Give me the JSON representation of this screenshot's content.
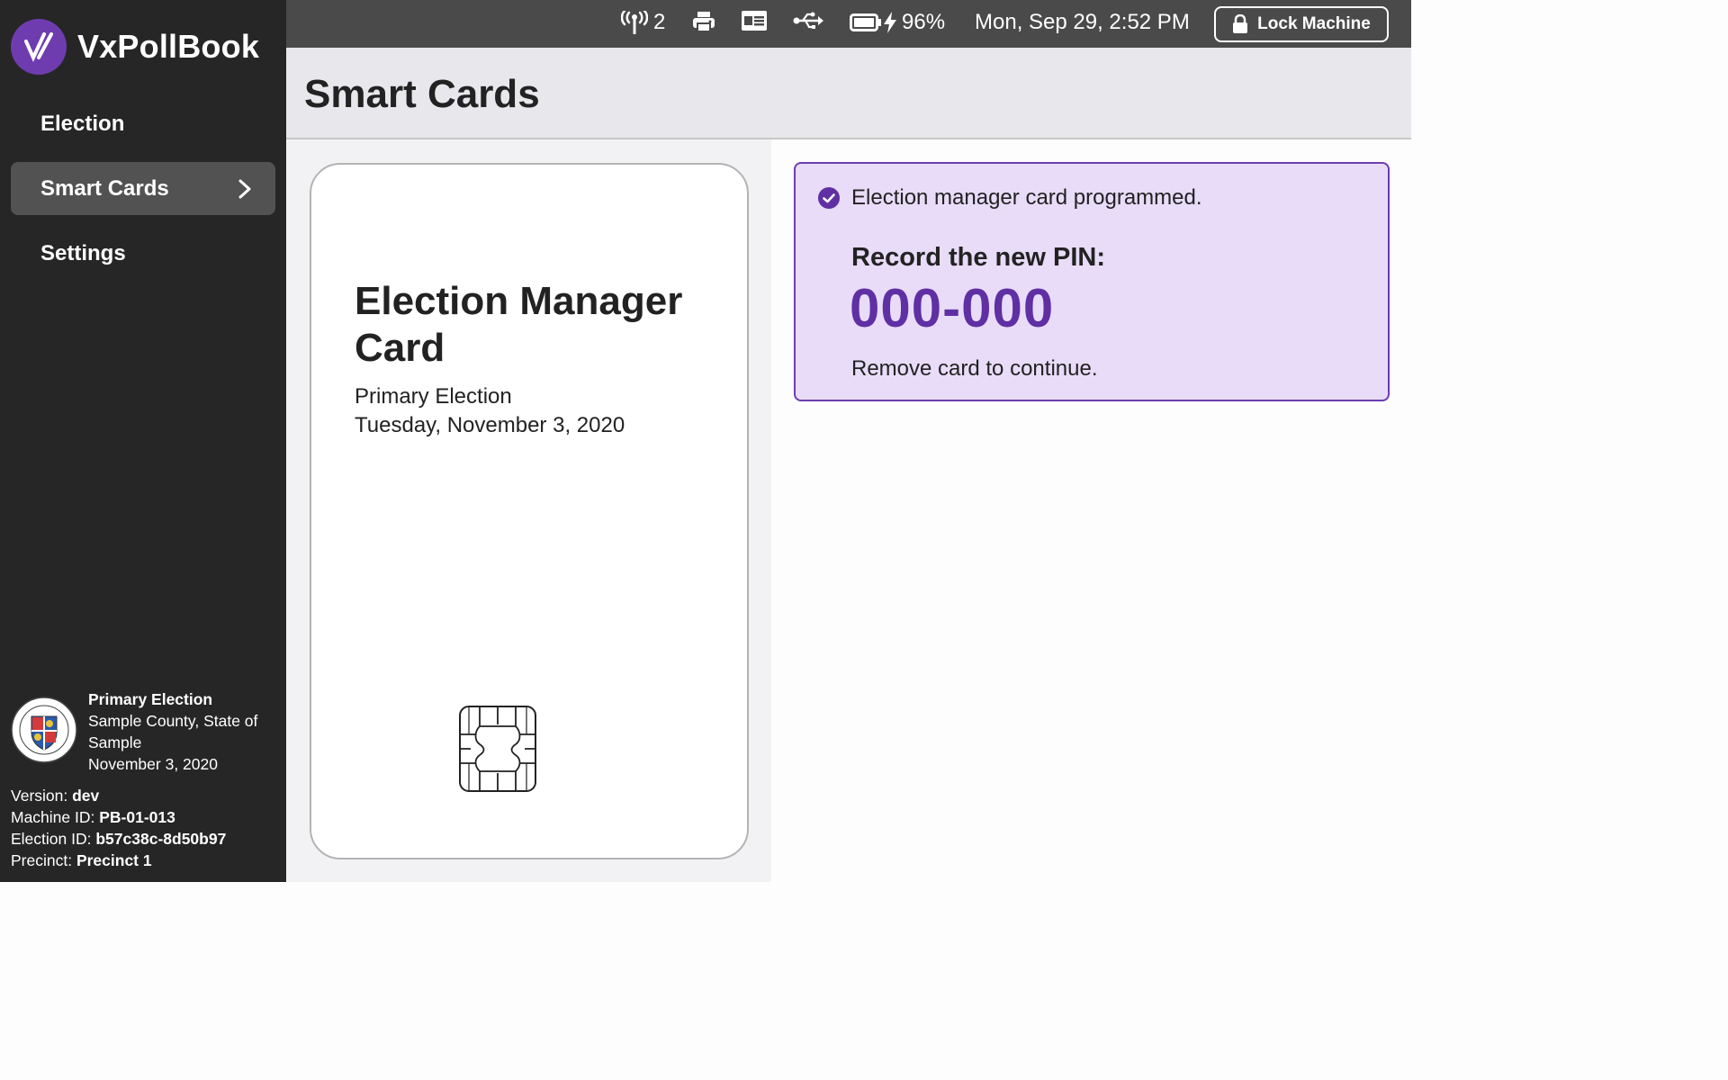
{
  "app": {
    "name": "VxPollBook"
  },
  "sidebar": {
    "items": [
      {
        "label": "Election",
        "active": false
      },
      {
        "label": "Smart Cards",
        "active": true
      },
      {
        "label": "Settings",
        "active": false
      }
    ],
    "election": {
      "title": "Primary Election",
      "jurisdiction": "Sample County, State of Sample",
      "date": "November 3, 2020"
    },
    "machine": {
      "version_label": "Version:",
      "version": "dev",
      "machine_id_label": "Machine ID:",
      "machine_id": "PB-01-013",
      "election_id_label": "Election ID:",
      "election_id": "b57c38c-8d50b97",
      "precinct_label": "Precinct:",
      "precinct": "Precinct 1"
    }
  },
  "topbar": {
    "network_count": "2",
    "battery": "96%",
    "datetime": "Mon, Sep 29, 2:52 PM",
    "lock_label": "Lock Machine"
  },
  "page": {
    "title": "Smart Cards"
  },
  "card": {
    "title": "Election Manager Card",
    "election_name": "Primary Election",
    "election_date": "Tuesday, November 3, 2020"
  },
  "callout": {
    "message": "Election manager card programmed.",
    "pin_label": "Record the new PIN:",
    "pin": "000-000",
    "remove_message": "Remove card to continue."
  },
  "colors": {
    "accent": "#6f3cb0",
    "callout_bg": "#e8dcf8",
    "sidebar": "#262626",
    "topbar": "#4a4a4a"
  },
  "icons": [
    "vx-logo-icon",
    "antenna-icon",
    "printer-icon",
    "card-reader-icon",
    "usb-icon",
    "battery-icon",
    "charging-bolt-icon",
    "lock-icon",
    "chevron-right-icon",
    "check-circle-icon",
    "smart-card-chip-icon",
    "county-seal"
  ]
}
